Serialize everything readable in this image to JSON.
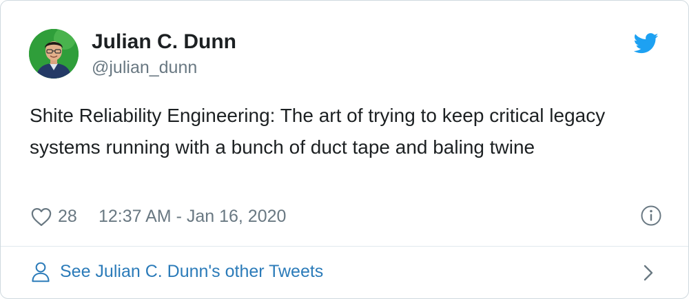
{
  "author": {
    "name": "Julian C. Dunn",
    "handle": "@julian_dunn"
  },
  "tweet": {
    "text": "Shite Reliability Engineering: The art of trying to keep critical legacy systems running with a bunch of duct tape and baling twine",
    "like_count": "28",
    "timestamp": "12:37 AM - Jan 16, 2020"
  },
  "footer": {
    "link_label": "See Julian C. Dunn's other Tweets"
  },
  "icons": {
    "brand": "twitter-bird-icon",
    "like": "heart-icon",
    "info": "info-icon",
    "profile": "person-icon",
    "more": "chevron-right-icon"
  },
  "colors": {
    "brand_blue": "#1da1f2",
    "link_blue": "#2b7bb9",
    "muted_text": "#697882",
    "main_text": "#1c2022",
    "border": "#cfd9de",
    "avatar_background": "#2f9e3a"
  }
}
